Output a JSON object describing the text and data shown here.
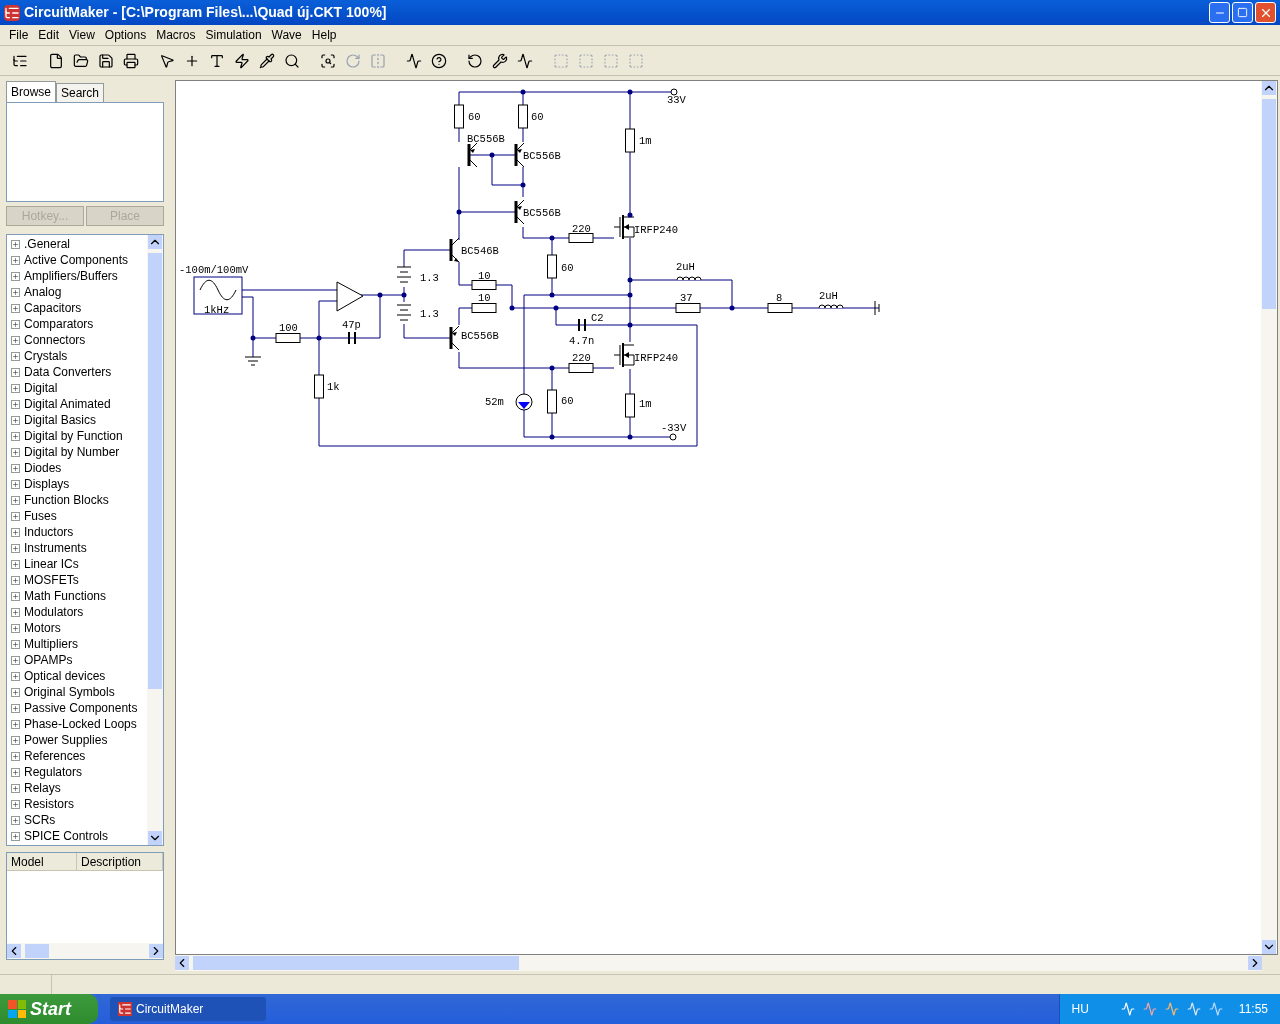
{
  "window": {
    "title": "CircuitMaker - [C:\\Program Files\\...\\Quad új.CKT 100%]"
  },
  "menu": [
    "File",
    "Edit",
    "View",
    "Options",
    "Macros",
    "Simulation",
    "Wave",
    "Help"
  ],
  "sidebar": {
    "tabs": [
      {
        "label": "Browse",
        "selected": true
      },
      {
        "label": "Search",
        "selected": false
      }
    ],
    "buttons": [
      {
        "label": "Hotkey...",
        "disabled": true
      },
      {
        "label": "Place",
        "disabled": true
      }
    ],
    "library": [
      {
        "label": ".General",
        "expanded": false
      },
      {
        "label": "Active Components",
        "expanded": false
      },
      {
        "label": "Amplifiers/Buffers",
        "expanded": false
      },
      {
        "label": "Analog",
        "expanded": false
      },
      {
        "label": "Capacitors",
        "expanded": false
      },
      {
        "label": "Comparators",
        "expanded": false
      },
      {
        "label": "Connectors",
        "expanded": false
      },
      {
        "label": "Crystals",
        "expanded": false
      },
      {
        "label": "Data Converters",
        "expanded": false
      },
      {
        "label": "Digital",
        "expanded": false
      },
      {
        "label": "Digital Animated",
        "expanded": false
      },
      {
        "label": "Digital Basics",
        "expanded": false
      },
      {
        "label": "Digital by Function",
        "expanded": false
      },
      {
        "label": "Digital by Number",
        "expanded": false
      },
      {
        "label": "Diodes",
        "expanded": false
      },
      {
        "label": "Displays",
        "expanded": false
      },
      {
        "label": "Function Blocks",
        "expanded": false
      },
      {
        "label": "Fuses",
        "expanded": false
      },
      {
        "label": "Inductors",
        "expanded": false
      },
      {
        "label": "Instruments",
        "expanded": false
      },
      {
        "label": "Linear ICs",
        "expanded": false
      },
      {
        "label": "MOSFETs",
        "expanded": false
      },
      {
        "label": "Math Functions",
        "expanded": false
      },
      {
        "label": "Modulators",
        "expanded": false
      },
      {
        "label": "Motors",
        "expanded": false
      },
      {
        "label": "Multipliers",
        "expanded": false
      },
      {
        "label": "OPAMPs",
        "expanded": false
      },
      {
        "label": "Optical devices",
        "expanded": false
      },
      {
        "label": "Original Symbols",
        "expanded": false
      },
      {
        "label": "Passive Components",
        "expanded": false
      },
      {
        "label": "Phase-Locked Loops",
        "expanded": false
      },
      {
        "label": "Power Supplies",
        "expanded": false
      },
      {
        "label": "References",
        "expanded": false
      },
      {
        "label": "Regulators",
        "expanded": false
      },
      {
        "label": "Relays",
        "expanded": false
      },
      {
        "label": "Resistors",
        "expanded": false
      },
      {
        "label": "SCRs",
        "expanded": false
      },
      {
        "label": "SPICE Controls",
        "expanded": false
      }
    ],
    "columns": [
      "Model",
      "Description"
    ]
  },
  "schematic": {
    "labels": [
      "60",
      "60",
      "33V",
      "BC556B",
      "BC556B",
      "1m",
      "BC556B",
      "220",
      "IRFP240",
      "BC546B",
      "-100m/100mV",
      "60",
      "2uH",
      "1.3",
      "10",
      "10",
      "37",
      "8",
      "2uH",
      "1kHz",
      "1.3",
      "C2",
      "100",
      "47p",
      "BC556B",
      "4.7n",
      "220",
      "IRFP240",
      "1k",
      "52m",
      "60",
      "1m",
      "-33V"
    ]
  },
  "taskbar": {
    "start": "Start",
    "tasks": [
      "CircuitMaker"
    ],
    "language": "HU",
    "clock": "11:55"
  }
}
